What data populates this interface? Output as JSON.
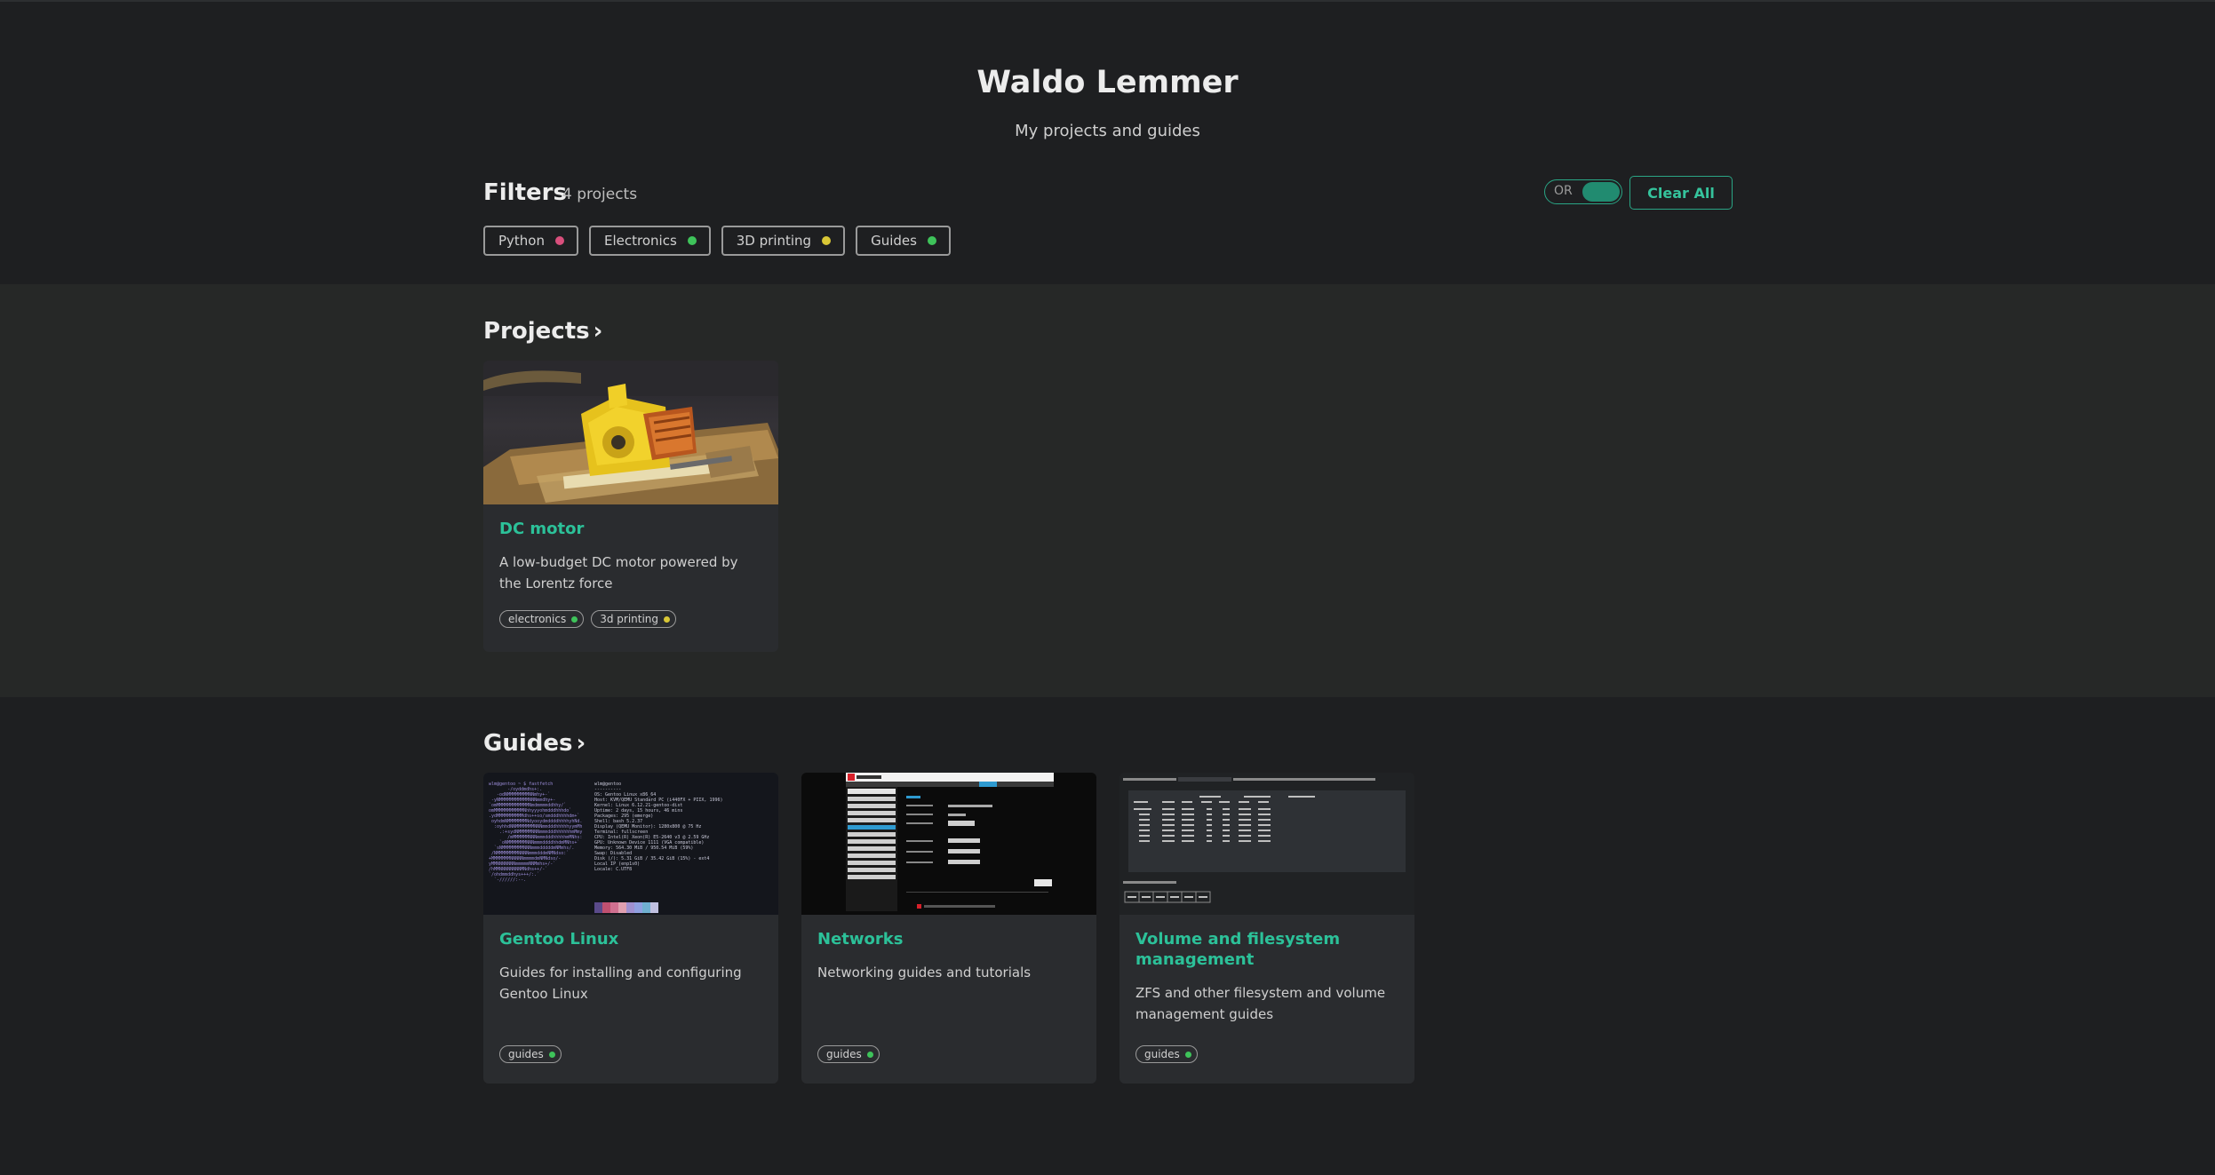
{
  "site": {
    "title": "Waldo Lemmer",
    "subtitle": "My projects and guides"
  },
  "filters": {
    "title": "Filters",
    "count": "4 projects",
    "toggle_label": "OR",
    "clear_label": "Clear All",
    "chips": [
      {
        "label": "Python",
        "color": "#d94f7c"
      },
      {
        "label": "Electronics",
        "color": "#3ec35a"
      },
      {
        "label": "3D printing",
        "color": "#d9c736"
      },
      {
        "label": "Guides",
        "color": "#3ec35a"
      }
    ]
  },
  "projects": {
    "title": "Projects",
    "chevron": "›",
    "cards": [
      {
        "title": "DC motor",
        "description": "A low-budget DC motor powered by the Lorentz force",
        "tags": [
          {
            "label": "electronics",
            "color": "#3ec35a"
          },
          {
            "label": "3d printing",
            "color": "#d9c736"
          }
        ]
      }
    ]
  },
  "guides": {
    "title": "Guides",
    "chevron": "›",
    "cards": [
      {
        "title": "Gentoo Linux",
        "description": "Guides for installing and configuring Gentoo Linux",
        "tags": [
          {
            "label": "guides",
            "color": "#3ec35a"
          }
        ]
      },
      {
        "title": "Networks",
        "description": "Networking guides and tutorials",
        "tags": [
          {
            "label": "guides",
            "color": "#3ec35a"
          }
        ]
      },
      {
        "title": "Volume and filesystem management",
        "description": "ZFS and other filesystem and volume management guides",
        "tags": [
          {
            "label": "guides",
            "color": "#3ec35a"
          }
        ]
      }
    ]
  }
}
